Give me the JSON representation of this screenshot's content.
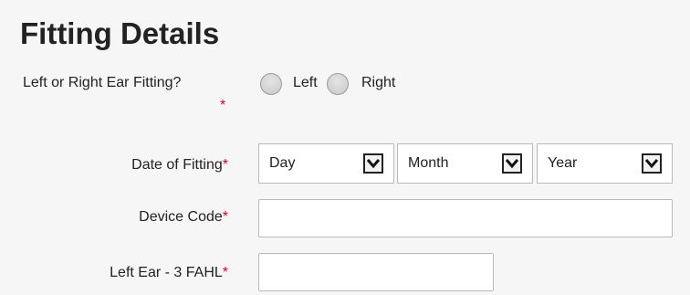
{
  "section": {
    "title": "Fitting Details"
  },
  "ear_fitting": {
    "label": "Left or Right Ear Fitting?",
    "required_mark": "*",
    "options": [
      {
        "label": "Left"
      },
      {
        "label": "Right"
      }
    ]
  },
  "date_of_fitting": {
    "label": "Date of Fitting",
    "required_mark": "*",
    "day": "Day",
    "month": "Month",
    "year": "Year"
  },
  "device_code": {
    "label": "Device Code",
    "required_mark": "*",
    "value": ""
  },
  "left_ear_fahl": {
    "label": "Left Ear - 3 FAHL",
    "required_mark": "*",
    "value": ""
  }
}
